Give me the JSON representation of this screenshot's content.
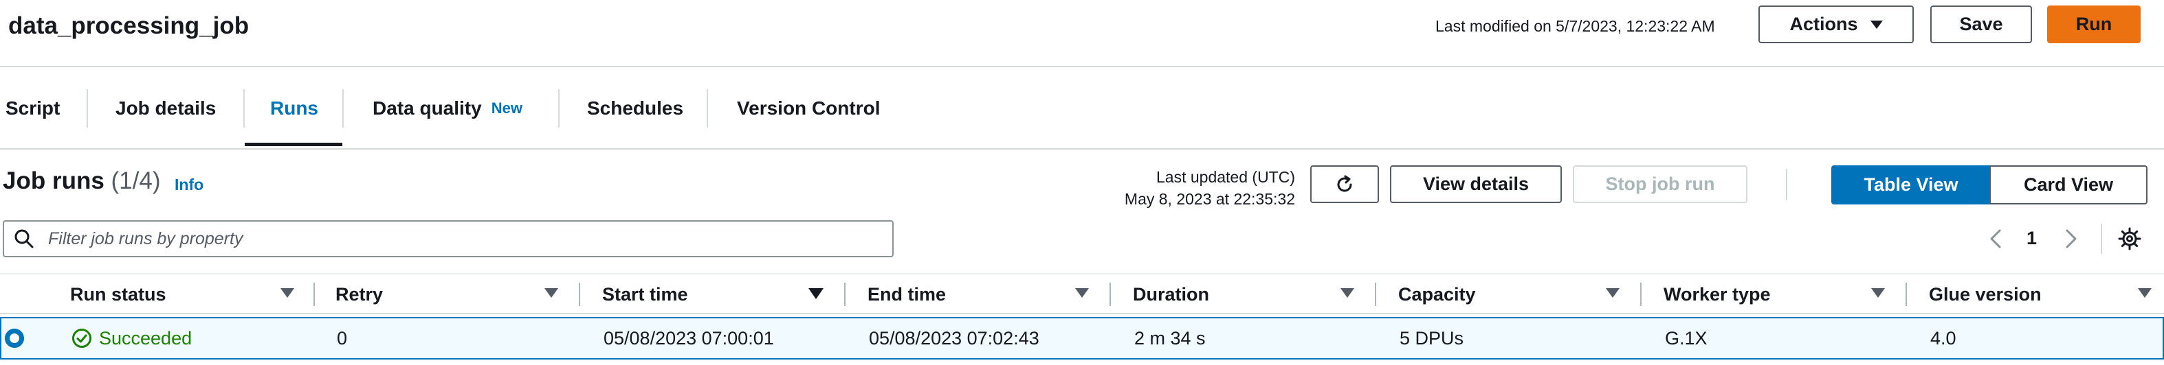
{
  "header": {
    "title": "data_processing_job",
    "last_modified": "Last modified on 5/7/2023, 12:23:22 AM",
    "actions_label": "Actions",
    "save_label": "Save",
    "run_label": "Run"
  },
  "tabs": [
    {
      "label": "Script"
    },
    {
      "label": "Job details"
    },
    {
      "label": "Runs",
      "active": true
    },
    {
      "label": "Data quality",
      "badge": "New"
    },
    {
      "label": "Schedules"
    },
    {
      "label": "Version Control"
    }
  ],
  "section": {
    "title": "Job runs",
    "count": "(1/4)",
    "info": "Info",
    "last_updated_label": "Last updated (UTC)",
    "last_updated_value": "May 8, 2023 at 22:35:32",
    "view_details_label": "View details",
    "stop_job_run_label": "Stop job run",
    "table_view_label": "Table View",
    "card_view_label": "Card View",
    "active_view": "Table View"
  },
  "filter": {
    "placeholder": "Filter job runs by property"
  },
  "pagination": {
    "current_page": "1"
  },
  "table": {
    "columns": [
      "Run status",
      "Retry",
      "Start time",
      "End time",
      "Duration",
      "Capacity",
      "Worker type",
      "Glue version"
    ],
    "sorted_column": "Start time",
    "rows": [
      {
        "selected": true,
        "run_status": "Succeeded",
        "retry": "0",
        "start_time": "05/08/2023 07:00:01",
        "end_time": "05/08/2023 07:02:43",
        "duration": "2 m 34 s",
        "capacity": "5 DPUs",
        "worker_type": "G.1X",
        "glue_version": "4.0"
      }
    ]
  },
  "colors": {
    "accent": "#0073bb",
    "run_button": "#ec7211",
    "success": "#1d8102",
    "text": "#16191f"
  },
  "icons": {
    "actions": "caret-down-icon",
    "refresh": "refresh-icon",
    "filter": "search-icon",
    "prev": "chevron-left-icon",
    "next": "chevron-right-icon",
    "settings": "gear-icon",
    "status": "check-circle-icon"
  }
}
